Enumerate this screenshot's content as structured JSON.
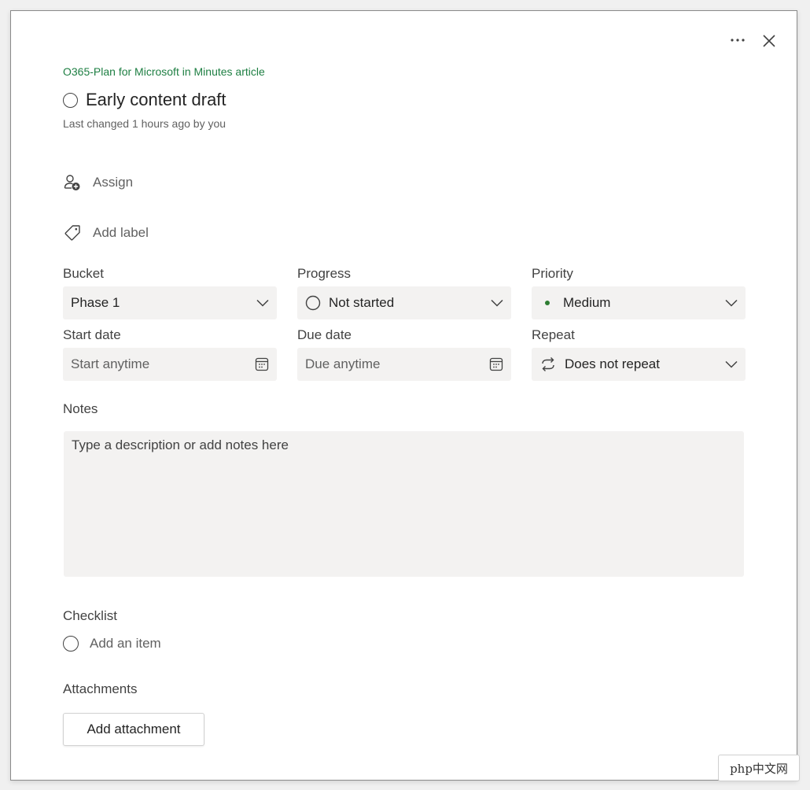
{
  "header": {
    "plan_name": "O365-Plan for Microsoft in Minutes article",
    "task_title": "Early content draft",
    "last_changed": "Last changed 1 hours ago by you",
    "more_icon": "more-horizontal-icon",
    "close_icon": "close-icon"
  },
  "actions": {
    "assign_label": "Assign",
    "add_label_label": "Add label"
  },
  "fields": {
    "bucket": {
      "label": "Bucket",
      "value": "Phase 1"
    },
    "progress": {
      "label": "Progress",
      "value": "Not started"
    },
    "priority": {
      "label": "Priority",
      "value": "Medium",
      "dot_color": "#2e7d32"
    },
    "start_date": {
      "label": "Start date",
      "placeholder": "Start anytime"
    },
    "due_date": {
      "label": "Due date",
      "placeholder": "Due anytime"
    },
    "repeat": {
      "label": "Repeat",
      "value": "Does not repeat"
    }
  },
  "notes": {
    "label": "Notes",
    "placeholder": "Type a description or add notes here"
  },
  "checklist": {
    "label": "Checklist",
    "add_item": "Add an item"
  },
  "attachments": {
    "label": "Attachments",
    "button": "Add attachment"
  },
  "watermark": "php中文网",
  "colors": {
    "plan_name": "#1e7f43",
    "field_bg": "#f3f2f1"
  }
}
